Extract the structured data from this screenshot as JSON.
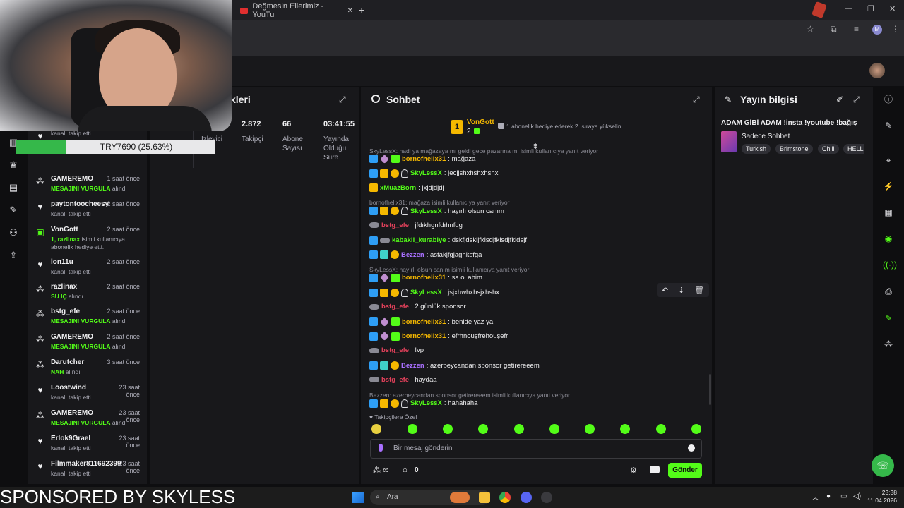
{
  "browser": {
    "tab_title": "Değmesin Ellerimiz - YouTu"
  },
  "donation": {
    "label": "TRY7690 (25.63%)",
    "progress_percent": 25.63
  },
  "activity": [
    {
      "name": "kanalı takip etti",
      "time": "",
      "desc": "",
      "icon": "heart-icon"
    },
    {
      "name": "GAMEREMO",
      "time": "1 saat önce",
      "desc_hl": "MESAJINI VURGULA",
      "desc": " alındı",
      "icon": "kick-icon"
    },
    {
      "name": "paytontoocheesy",
      "time": "2 saat önce",
      "desc": "kanalı takip etti",
      "icon": "heart-icon"
    },
    {
      "name": "VonGott",
      "time": "2 saat önce",
      "desc_hl": "1, razlinax",
      "desc": " isimli kullanıcıya abonelik hediye etti.",
      "icon": "gift-icon"
    },
    {
      "name": "lon11u",
      "time": "2 saat önce",
      "desc": "kanalı takip etti",
      "icon": "heart-icon"
    },
    {
      "name": "razlinax",
      "time": "2 saat önce",
      "desc_hl": "SU İÇ",
      "desc": " alındı",
      "icon": "kick-icon"
    },
    {
      "name": "bstg_efe",
      "time": "2 saat önce",
      "desc_hl": "MESAJINI VURGULA",
      "desc": " alındı",
      "icon": "kick-icon"
    },
    {
      "name": "GAMEREMO",
      "time": "2 saat önce",
      "desc_hl": "MESAJINI VURGULA",
      "desc": " alındı",
      "icon": "kick-icon"
    },
    {
      "name": "Darutcher",
      "time": "3 saat önce",
      "desc_hl": "NAH",
      "desc": " alındı",
      "icon": "kick-icon"
    },
    {
      "name": "Loostwind",
      "time": "23 saat önce",
      "desc": "kanalı takip etti",
      "icon": "heart-icon"
    },
    {
      "name": "GAMEREMO",
      "time": "23 saat önce",
      "desc_hl": "MESAJINI VURGULA",
      "desc": " alındı",
      "icon": "kick-icon"
    },
    {
      "name": "Erlok9Grael",
      "time": "23 saat önce",
      "desc": "kanalı takip etti",
      "icon": "heart-icon"
    },
    {
      "name": "Filmmaker811692399",
      "time": "23 saat önce",
      "desc": "kanalı takip etti",
      "icon": "heart-icon"
    }
  ],
  "stats": {
    "title": "kleri",
    "viewers_label": "İzleyici",
    "followers_value": "2.872",
    "followers_label": "Takipçi",
    "subs_value": "66",
    "subs_label": "Abone Sayısı",
    "uptime_value": "03:41:55",
    "uptime_label": "Yayında Olduğu Süre"
  },
  "chat": {
    "title": "Sohbet",
    "pinned_user": "VonGott",
    "pinned_count": "2",
    "pinned_crown": "1",
    "pinned_text": "1 abonelik hediye ederek 2. sıraya yükselin",
    "top_reply": "SkyLessX: hadi ya mağazaya mı geldi gece pazarına mı isimli kullanıcıya yanıt veriyor",
    "lines": [
      {
        "type": "msg",
        "badges": [
          "b-blue",
          "b-diamond",
          "b-green"
        ],
        "user": "bornofhelix31",
        "color": "#f5b800",
        "text": ": mağaza"
      },
      {
        "type": "msg",
        "badges": [
          "b-blue",
          "b-crown",
          "b-gold",
          "b-fire"
        ],
        "user": "SkyLessX",
        "color": "#53fc18",
        "text": ": jecjjshxhshxhshx"
      },
      {
        "type": "msg",
        "badges": [
          "b-crown"
        ],
        "user": "xMuazBorn",
        "color": "#53fc18",
        "text": ": jxjdjdjdj"
      },
      {
        "type": "reply",
        "text": "bornofhelix31: mağaza isimli kullanıcıya yanıt veriyor"
      },
      {
        "type": "msg",
        "badges": [
          "b-blue",
          "b-crown",
          "b-gold",
          "b-fire"
        ],
        "user": "SkyLessX",
        "color": "#53fc18",
        "text": ": hayırlı olsun canım"
      },
      {
        "type": "msg",
        "badges": [
          "b-plane"
        ],
        "user": "bstg_efe",
        "color": "#e0405a",
        "text": ": jfdıkhgnfdıhnfdg"
      },
      {
        "type": "msg",
        "badges": [
          "b-blue",
          "b-plane"
        ],
        "user": "kabakli_kurabiye",
        "color": "#53fc18",
        "text": ": dskfjdskljfklsdjfklsdjfkldsjf"
      },
      {
        "type": "msg",
        "badges": [
          "b-blue",
          "b-multi",
          "b-gold"
        ],
        "user": "Bezzen",
        "color": "#a970ff",
        "text": ": asfakjfgjaghksfga"
      },
      {
        "type": "reply",
        "text": "SkyLessX: hayırlı olsun canım isimli kullanıcıya yanıt veriyor"
      },
      {
        "type": "msg",
        "badges": [
          "b-blue",
          "b-diamond",
          "b-green"
        ],
        "user": "bornofhelix31",
        "color": "#f5b800",
        "text": ": sa ol abim"
      },
      {
        "type": "msg",
        "badges": [
          "b-blue",
          "b-crown",
          "b-gold",
          "b-fire"
        ],
        "user": "SkyLessX",
        "color": "#53fc18",
        "text": ": jsjxhwhxhsjxhshx"
      },
      {
        "type": "msg",
        "badges": [
          "b-plane"
        ],
        "user": "bstg_efe",
        "color": "#e0405a",
        "text": ": 2 günlük sponsor"
      },
      {
        "type": "msg",
        "badges": [
          "b-blue",
          "b-diamond",
          "b-green"
        ],
        "user": "bornofhelix31",
        "color": "#f5b800",
        "text": ": benide yaz ya"
      },
      {
        "type": "msg",
        "badges": [
          "b-blue",
          "b-diamond",
          "b-green"
        ],
        "user": "bornofhelix31",
        "color": "#f5b800",
        "text": ": efrhnouşfrehouşefr"
      },
      {
        "type": "msg",
        "badges": [
          "b-plane"
        ],
        "user": "bstg_efe",
        "color": "#e0405a",
        "text": ": !vp"
      },
      {
        "type": "msg",
        "badges": [
          "b-blue",
          "b-multi",
          "b-gold"
        ],
        "user": "Bezzen",
        "color": "#a970ff",
        "text": ": azerbeycandan sponsor getirereeem"
      },
      {
        "type": "msg",
        "badges": [
          "b-plane"
        ],
        "user": "bstg_efe",
        "color": "#e0405a",
        "text": ": haydaa"
      },
      {
        "type": "reply",
        "text": "Bezzen: azerbeycandan sponsor getirereeem isimli kullanıcıya yanıt veriyor"
      },
      {
        "type": "msg",
        "badges": [
          "b-blue",
          "b-crown",
          "b-gold",
          "b-fire"
        ],
        "user": "SkyLessX",
        "color": "#53fc18",
        "text": ": hahahaha"
      }
    ],
    "followers_only": "Takipçilere Özel",
    "input_placeholder": "Bir mesaj gönderin",
    "infinity": "∞",
    "points": "0",
    "send_label": "Gönder"
  },
  "info": {
    "title": "Yayın bilgisi",
    "stream_title": "ADAM GİBİ ADAM !insta !youtube !bağış",
    "category": "Sadece Sohbet",
    "tags": [
      "Turkish",
      "Brimstone",
      "Chill",
      "HELLI"
    ]
  },
  "overlay": {
    "sponsor_text": "SPONSORED BY SKYLESS"
  },
  "taskbar": {
    "search_label": "Ara",
    "time": "23:38",
    "date": "11.04.2026"
  },
  "colors": {
    "accent": "#53fc18",
    "panel_bg": "#18181b",
    "page_bg": "#0e0e10"
  }
}
